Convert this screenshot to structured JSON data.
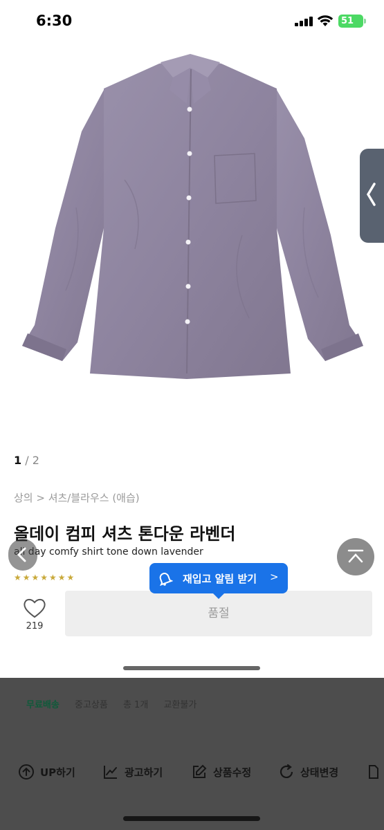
{
  "status": {
    "time": "6:30",
    "battery": "51"
  },
  "pager": {
    "current": "1",
    "total": "2"
  },
  "product": {
    "breadcrumb": "상의 > 셔츠/블라우스 (애습)",
    "title": "올데이 컴피 셔츠 톤다운 라벤더",
    "subtitle": "all day comfy shirt tone down lavender"
  },
  "tooltip": {
    "label": "재입고 알림 받기",
    "arrow": ">"
  },
  "like": {
    "count": "219"
  },
  "soldout": {
    "label": "품절"
  },
  "info": {
    "items": [
      "무료배송",
      "중고상품",
      "총 1개",
      "교환불가"
    ]
  },
  "bottom_actions": [
    "UP하기",
    "광고하기",
    "상품수정",
    "상태변경"
  ],
  "colors": {
    "shirt": "#8f85a0",
    "tooltip": "#1a73e8",
    "battery": "#4cd964",
    "side_tab": "#596270"
  }
}
